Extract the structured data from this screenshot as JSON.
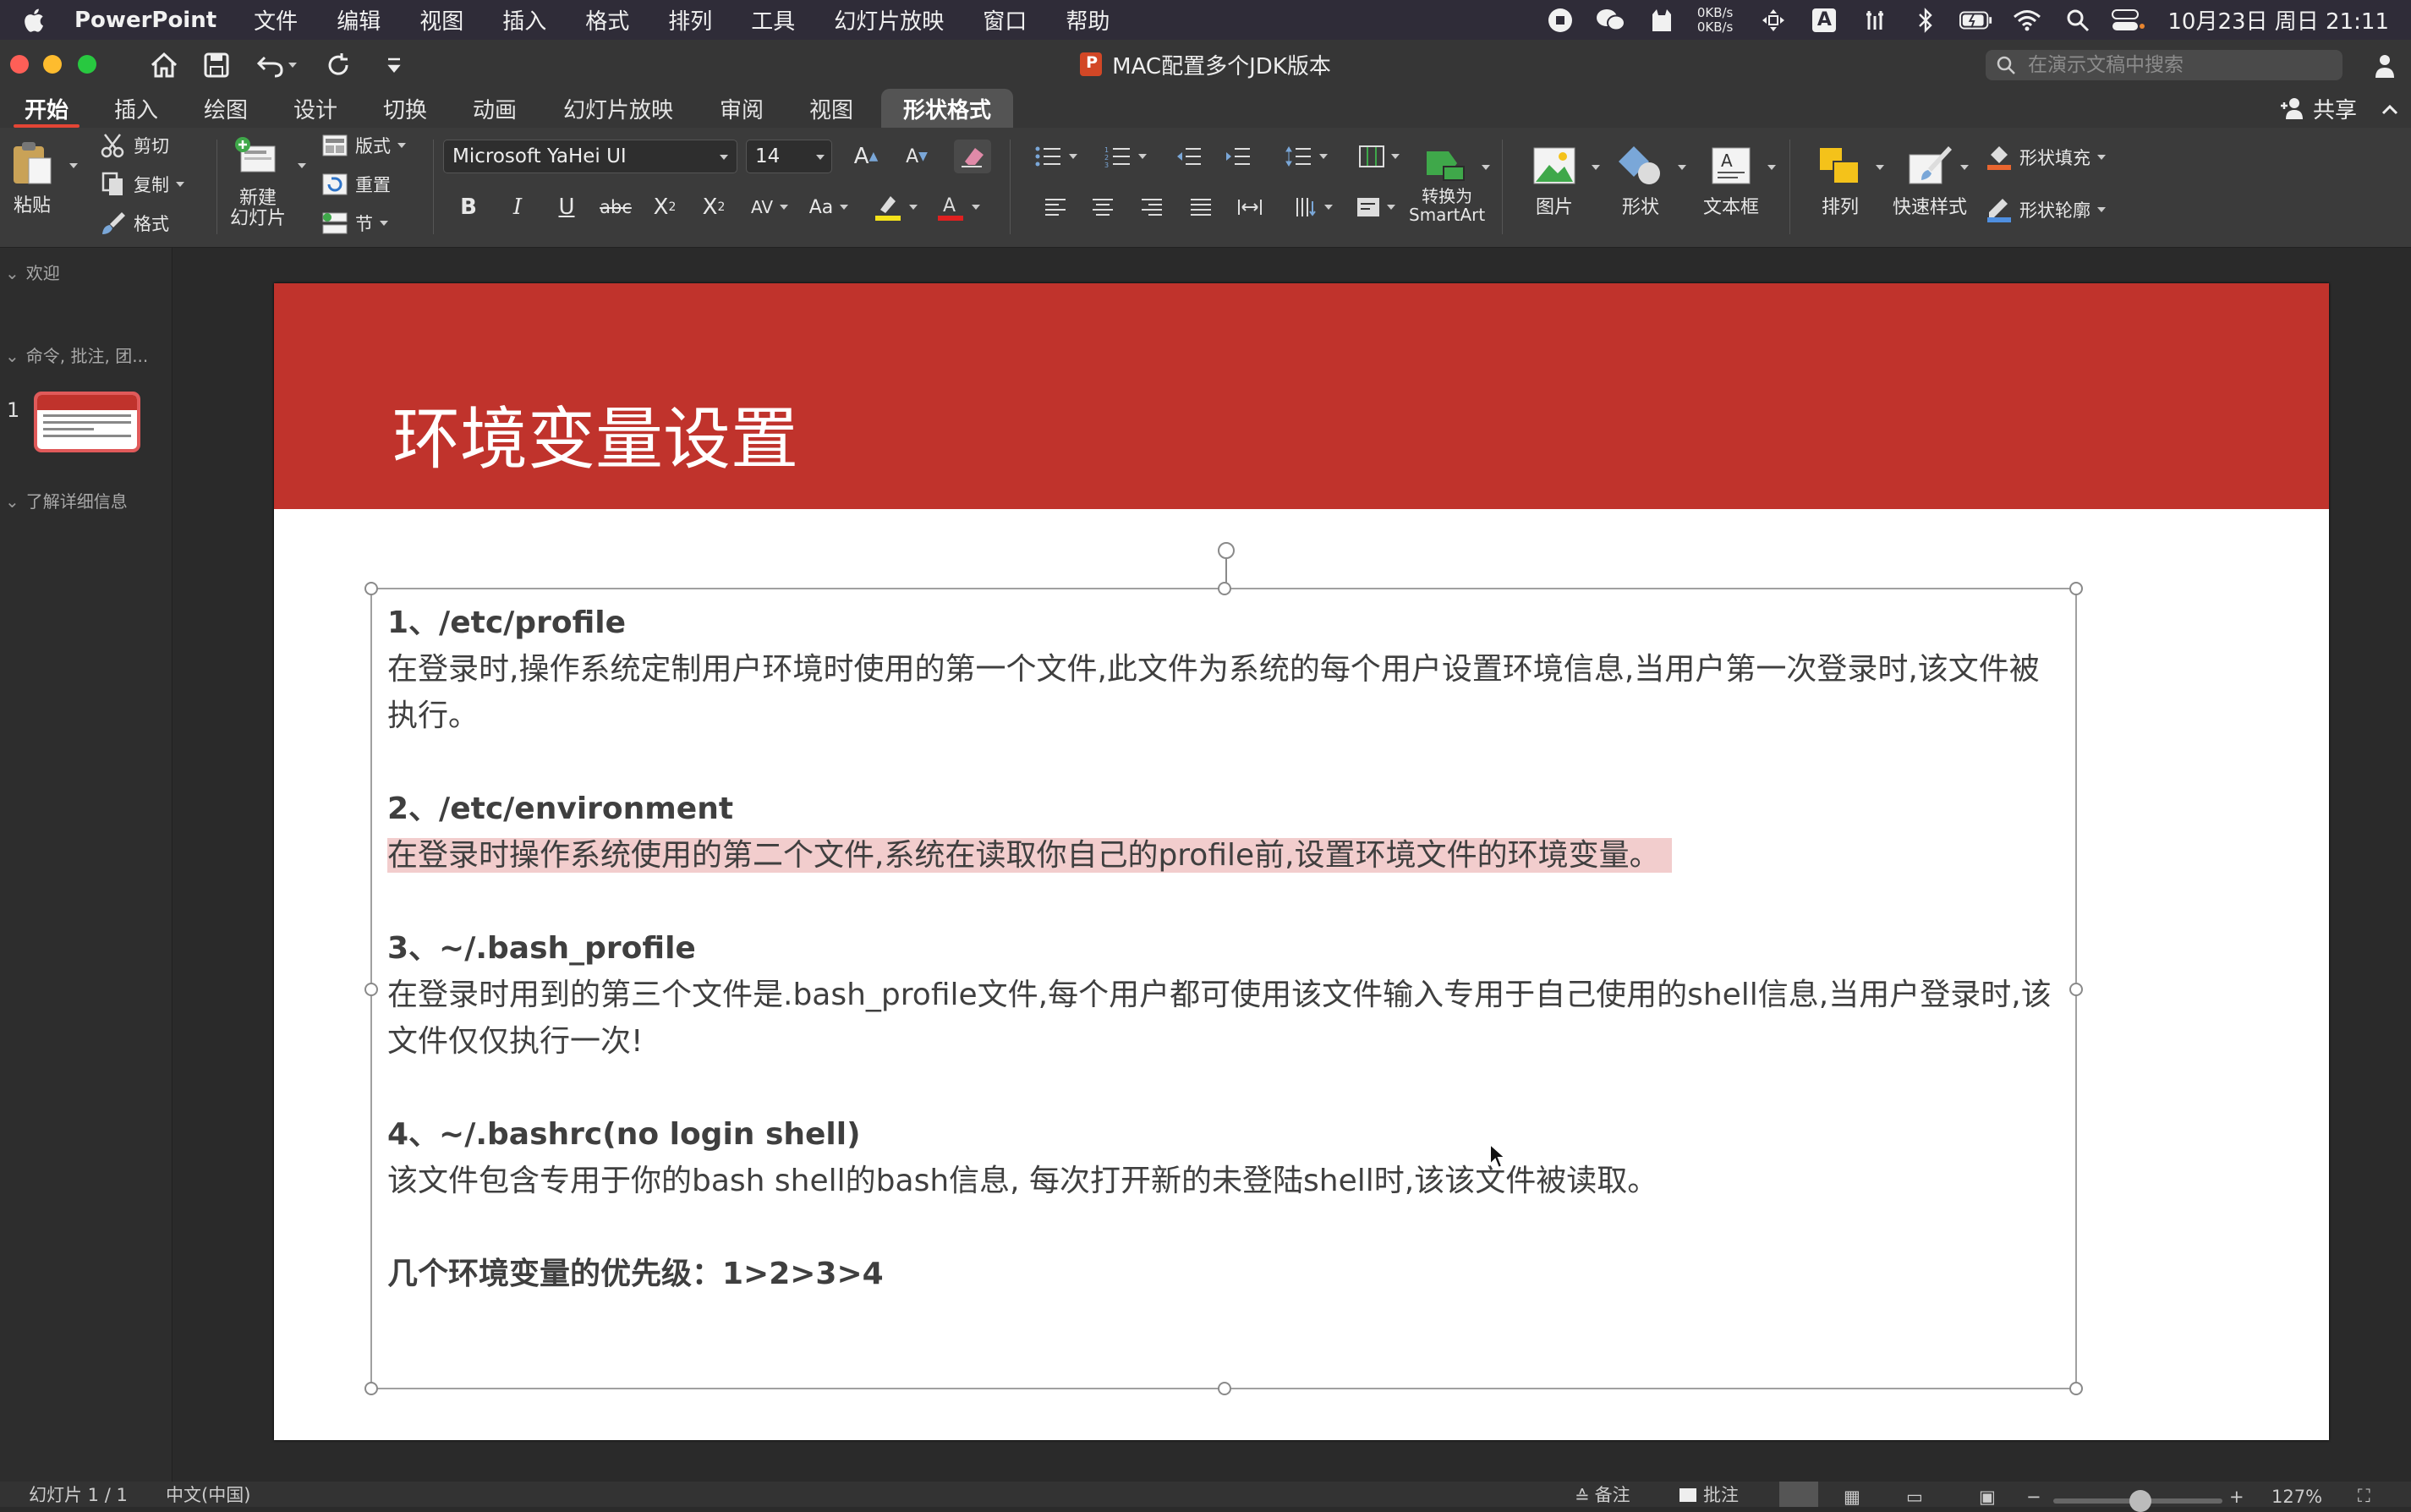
{
  "menubar": {
    "app_name": "PowerPoint",
    "items": [
      "文件",
      "编辑",
      "视图",
      "插入",
      "格式",
      "排列",
      "工具",
      "幻灯片放映",
      "窗口",
      "帮助"
    ],
    "net_up": "0KB/s",
    "net_down": "0KB/s",
    "ime": "A",
    "clock": "10月23日 周日 21:11"
  },
  "window": {
    "title": "MAC配置多个JDK版本",
    "search_placeholder": "在演示文稿中搜索"
  },
  "tabs": [
    "开始",
    "插入",
    "绘图",
    "设计",
    "切换",
    "动画",
    "幻灯片放映",
    "审阅",
    "视图",
    "形状格式"
  ],
  "active_tab": "开始",
  "share_label": "共享",
  "ribbon": {
    "paste": "粘贴",
    "cut": "剪切",
    "copy": "复制",
    "format_painter": "格式",
    "new_slide": "新建\n幻灯片",
    "layout": "版式",
    "reset": "重置",
    "section": "节",
    "font_name": "Microsoft YaHei UI",
    "font_size": "14",
    "convert_smartart": "转换为\nSmartArt",
    "picture": "图片",
    "shapes": "形状",
    "textbox": "文本框",
    "arrange": "排列",
    "quick_styles": "快速样式",
    "shape_fill": "形状填充",
    "shape_outline": "形状轮廓"
  },
  "sidebar": {
    "sections": [
      "欢迎",
      "命令, 批注, 团...",
      "了解详细信息"
    ],
    "slide_number": "1"
  },
  "slide": {
    "title": "环境变量设置",
    "items": [
      {
        "heading": "1、/etc/profile",
        "body": "在登录时,操作系统定制用户环境时使用的第一个文件,此文件为系统的每个用户设置环境信息,当用户第一次登录时,该文件被执行。"
      },
      {
        "heading": "2、/etc/environment",
        "body": "在登录时操作系统使用的第二个文件,系统在读取你自己的profile前,设置环境文件的环境变量。"
      },
      {
        "heading": "3、~/.bash_profile",
        "body": "在登录时用到的第三个文件是.bash_profile文件,每个用户都可使用该文件输入专用于自己使用的shell信息,当用户登录时,该 文件仅仅执行一次!"
      },
      {
        "heading": "4、~/.bashrc(no login shell)",
        "body": "该文件包含专用于你的bash shell的bash信息, 每次打开新的未登陆shell时,该该文件被读取。"
      }
    ],
    "summary": "几个环境变量的优先级：1>2>3>4"
  },
  "statusbar": {
    "slide_counter": "幻灯片 1 / 1",
    "language": "中文(中国)",
    "notes": "备注",
    "comments": "批注",
    "zoom": "127%"
  },
  "colors": {
    "title_bar_red": "#c0332c",
    "accent_tab": "#e34535",
    "highlight": "#f2cdcd"
  }
}
